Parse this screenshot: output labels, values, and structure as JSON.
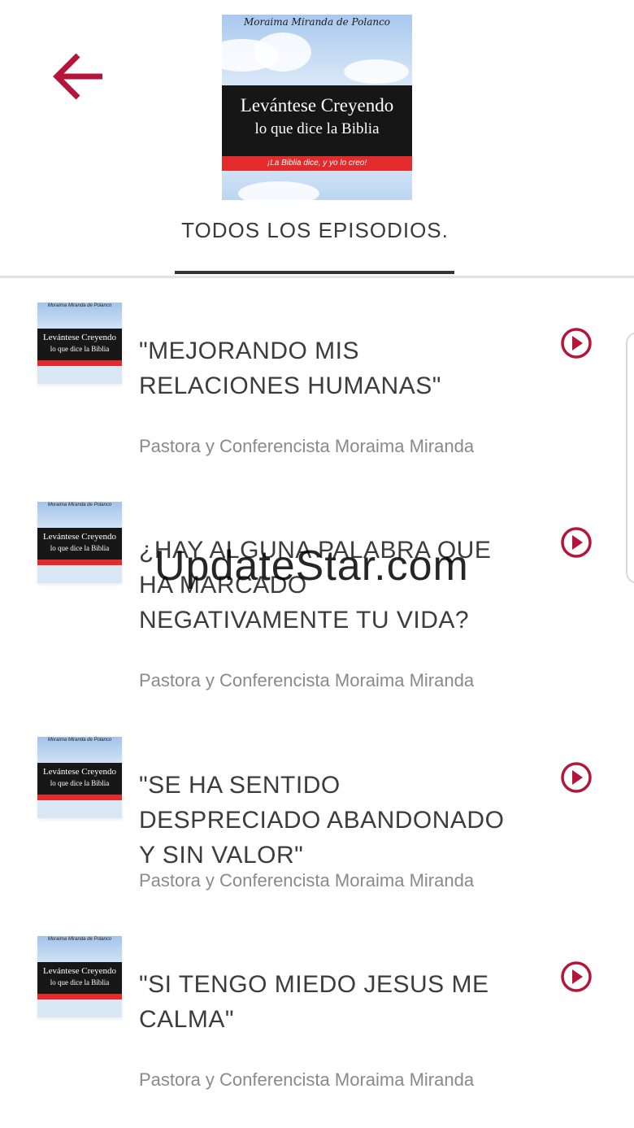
{
  "header": {
    "back_icon": "arrow-left-icon",
    "cover": {
      "author": "Moraima Miranda de Polanco",
      "title_line1": "Levántese Creyendo",
      "title_line2": "lo que dice la Biblia",
      "tagline": "¡La Biblia dice, y yo lo creo!"
    },
    "tab_label": "TODOS LOS EPISODIOS."
  },
  "colors": {
    "accent": "#b3163a",
    "text": "#3c3c3c",
    "muted": "#8a8a8a",
    "cover_band": "#161616",
    "cover_red": "#e32b2b"
  },
  "episodes": [
    {
      "title": "\"MEJORANDO MIS RELACIONES HUMANAS\"",
      "author": "Pastora y Conferencista Moraima Miranda",
      "thumb": {
        "line1": "Levántese Creyendo",
        "line2": "lo que dice la Biblia"
      }
    },
    {
      "title": "¿HAY ALGUNA PALABRA QUE HA MARCADO NEGATIVAMENTE TU VIDA?",
      "author": "Pastora y Conferencista Moraima Miranda",
      "thumb": {
        "line1": "Levántese Creyendo",
        "line2": "lo que dice la Biblia"
      }
    },
    {
      "title": "\"SE HA SENTIDO DESPRECIADO ABANDONADO Y SIN VALOR\"",
      "author": "Pastora y Conferencista Moraima Miranda",
      "thumb": {
        "line1": "Levántese Creyendo",
        "line2": "lo que dice la Biblia"
      }
    },
    {
      "title": "\"SI TENGO MIEDO JESUS ME CALMA\"",
      "author": "Pastora y Conferencista Moraima Miranda",
      "thumb": {
        "line1": "Levántese Creyendo",
        "line2": "lo que dice la Biblia"
      }
    }
  ],
  "watermark": "UpdateStar.com"
}
